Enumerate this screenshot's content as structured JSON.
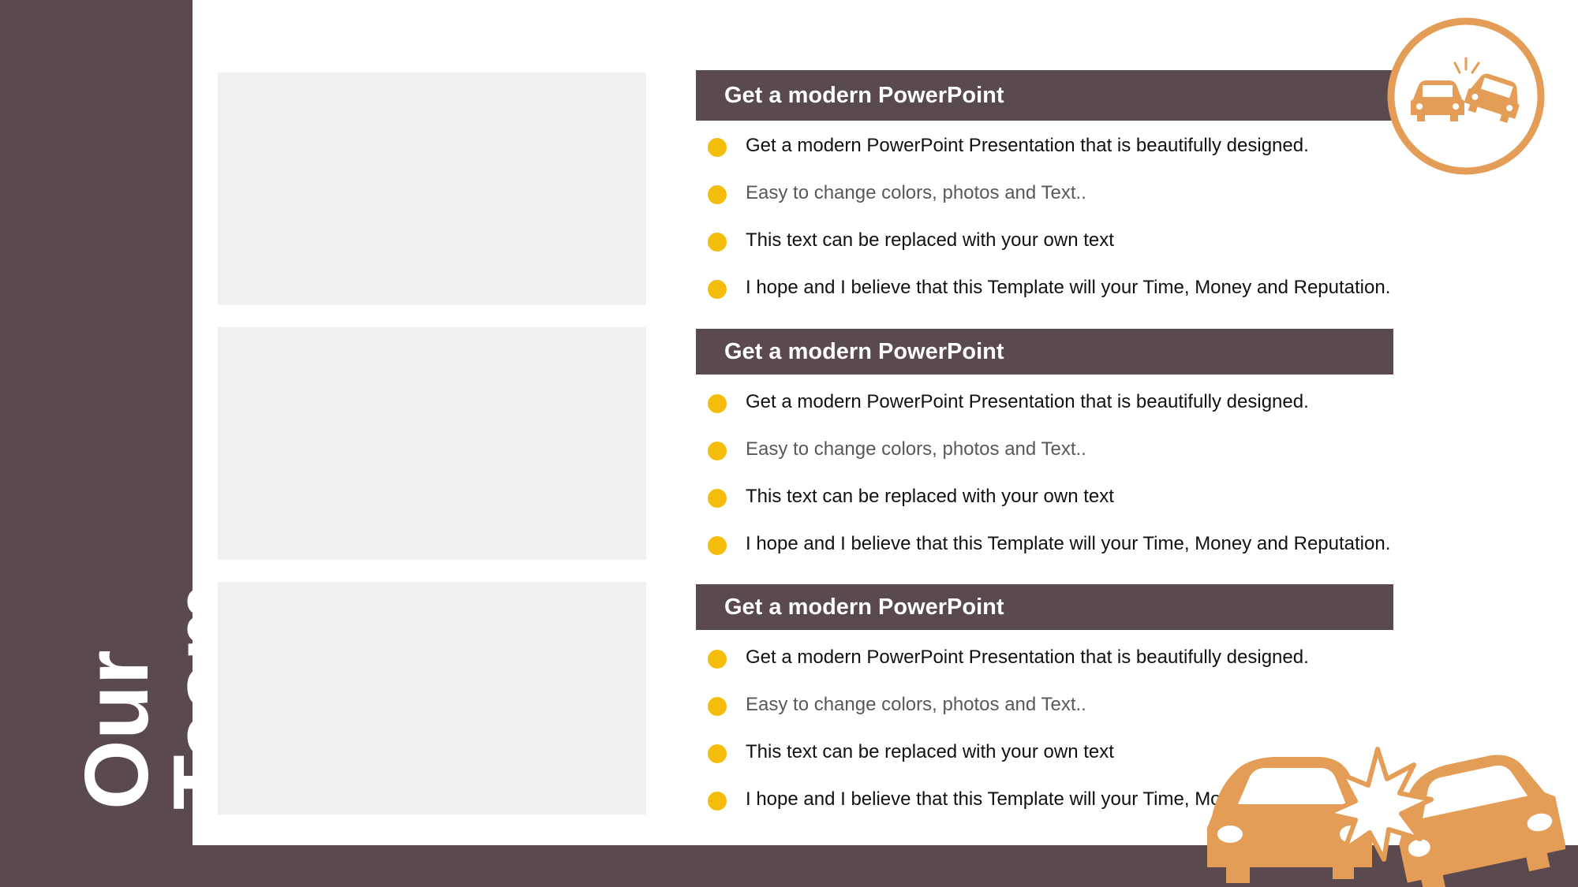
{
  "sidebar": {
    "title": "Our Team"
  },
  "sections": [
    {
      "header": "Get a modern PowerPoint",
      "bullets": [
        "Get a modern PowerPoint  Presentation that is beautifully designed.",
        "Easy to change colors, photos and Text..",
        "This text can be replaced with your own text",
        "I hope and I believe that this Template will your Time, Money and Reputation."
      ]
    },
    {
      "header": "Get a modern PowerPoint",
      "bullets": [
        "Get a modern PowerPoint  Presentation that is beautifully designed.",
        "Easy to change colors, photos and Text..",
        "This text can be replaced with your own text",
        "I hope and I believe that this Template will your Time, Money and Reputation."
      ]
    },
    {
      "header": "Get a modern PowerPoint",
      "bullets": [
        "Get a modern PowerPoint  Presentation that is beautifully designed.",
        "Easy to change colors, photos and Text..",
        "This text can be replaced with your own text",
        "I hope and I believe that this Template will your Time, Money and Reputation."
      ]
    }
  ],
  "icons": {
    "top_right": "car-crash-circle-icon",
    "bottom_right": "car-crash-icon"
  },
  "colors": {
    "brand_dark": "#5a494e",
    "bullet_yellow": "#f5bd0b",
    "icon_orange": "#e49d56",
    "photo_placeholder": "#f1f1f1"
  }
}
